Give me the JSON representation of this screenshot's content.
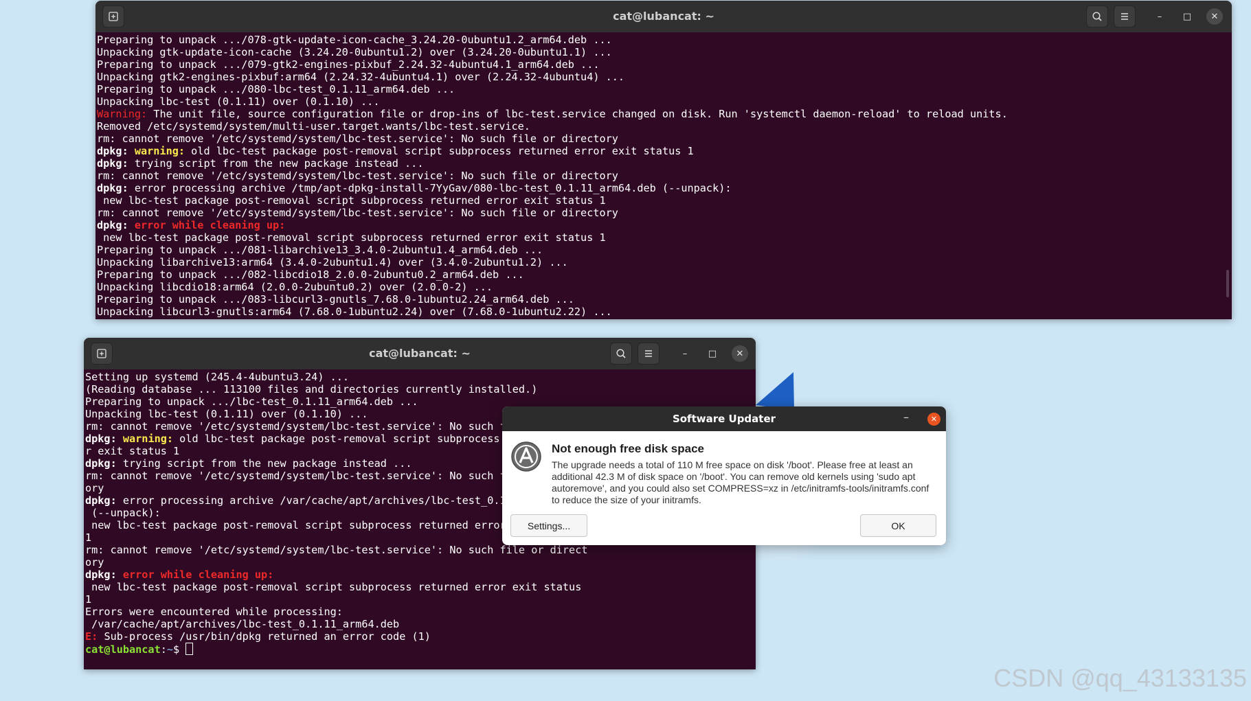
{
  "colors": {
    "terminal_bg": "#300a24",
    "titlebar_bg": "#303030",
    "dialog_accent": "#e95420",
    "error_red": "#ef2929",
    "warning_yellow": "#fce94f",
    "prompt_green": "#8ae234",
    "prompt_blue": "#729fcf",
    "desktop_bg": "#cde6f6"
  },
  "terminal_top": {
    "title": "cat@lubancat: ~",
    "icons": [
      "new-tab-icon",
      "search-icon",
      "menu-icon",
      "minimize-icon",
      "maximize-icon",
      "close-icon"
    ],
    "lines": [
      [
        {
          "t": "Preparing to unpack .../078-gtk-update-icon-cache_3.24.20-0ubuntu1.2_arm64.deb ..."
        }
      ],
      [
        {
          "t": "Unpacking gtk-update-icon-cache (3.24.20-0ubuntu1.2) over (3.24.20-0ubuntu1.1) ..."
        }
      ],
      [
        {
          "t": "Preparing to unpack .../079-gtk2-engines-pixbuf_2.24.32-4ubuntu4.1_arm64.deb ..."
        }
      ],
      [
        {
          "t": "Unpacking gtk2-engines-pixbuf:arm64 (2.24.32-4ubuntu4.1) over (2.24.32-4ubuntu4) ..."
        }
      ],
      [
        {
          "t": "Preparing to unpack .../080-lbc-test_0.1.11_arm64.deb ..."
        }
      ],
      [
        {
          "t": "Unpacking lbc-test (0.1.11) over (0.1.10) ..."
        }
      ],
      [
        {
          "t": "Warning:",
          "s": "red"
        },
        {
          "t": " The unit file, source configuration file or drop-ins of lbc-test.service changed on disk. Run 'systemctl daemon-reload' to reload units."
        }
      ],
      [
        {
          "t": "Removed /etc/systemd/system/multi-user.target.wants/lbc-test.service."
        }
      ],
      [
        {
          "t": "rm: cannot remove '/etc/systemd/system/lbc-test.service': No such file or directory"
        }
      ],
      [
        {
          "t": "dpkg:",
          "s": "b"
        },
        {
          "t": " "
        },
        {
          "t": "warning:",
          "s": "yelb"
        },
        {
          "t": " old lbc-test package post-removal script subprocess returned error exit status 1"
        }
      ],
      [
        {
          "t": "dpkg:",
          "s": "b"
        },
        {
          "t": " trying script from the new package instead ..."
        }
      ],
      [
        {
          "t": "rm: cannot remove '/etc/systemd/system/lbc-test.service': No such file or directory"
        }
      ],
      [
        {
          "t": "dpkg:",
          "s": "b"
        },
        {
          "t": " error processing archive /tmp/apt-dpkg-install-7YyGav/080-lbc-test_0.1.11_arm64.deb (--unpack):"
        }
      ],
      [
        {
          "t": " new lbc-test package post-removal script subprocess returned error exit status 1"
        }
      ],
      [
        {
          "t": "rm: cannot remove '/etc/systemd/system/lbc-test.service': No such file or directory"
        }
      ],
      [
        {
          "t": "dpkg:",
          "s": "b"
        },
        {
          "t": " "
        },
        {
          "t": "error while cleaning up:",
          "s": "redb"
        }
      ],
      [
        {
          "t": " new lbc-test package post-removal script subprocess returned error exit status 1"
        }
      ],
      [
        {
          "t": "Preparing to unpack .../081-libarchive13_3.4.0-2ubuntu1.4_arm64.deb ..."
        }
      ],
      [
        {
          "t": "Unpacking libarchive13:arm64 (3.4.0-2ubuntu1.4) over (3.4.0-2ubuntu1.2) ..."
        }
      ],
      [
        {
          "t": "Preparing to unpack .../082-libcdio18_2.0.0-2ubuntu0.2_arm64.deb ..."
        }
      ],
      [
        {
          "t": "Unpacking libcdio18:arm64 (2.0.0-2ubuntu0.2) over (2.0.0-2) ..."
        }
      ],
      [
        {
          "t": "Preparing to unpack .../083-libcurl3-gnutls_7.68.0-1ubuntu2.24_arm64.deb ..."
        }
      ],
      [
        {
          "t": "Unpacking libcurl3-gnutls:arm64 (7.68.0-1ubuntu2.24) over (7.68.0-1ubuntu2.22) ..."
        }
      ]
    ]
  },
  "terminal_bottom": {
    "title": "cat@lubancat: ~",
    "icons": [
      "new-tab-icon",
      "search-icon",
      "menu-icon",
      "minimize-icon",
      "maximize-icon",
      "close-icon"
    ],
    "lines": [
      [
        {
          "t": "Setting up systemd (245.4-4ubuntu3.24) ..."
        }
      ],
      [
        {
          "t": "(Reading database ... 113100 files and directories currently installed.)"
        }
      ],
      [
        {
          "t": "Preparing to unpack .../lbc-test_0.1.11_arm64.deb ..."
        }
      ],
      [
        {
          "t": "Unpacking lbc-test (0.1.11) over (0.1.10) ..."
        }
      ],
      [
        {
          "t": "rm: cannot remove '/etc/systemd/system/lbc-test.service': No such fi"
        }
      ],
      [
        {
          "t": "dpkg:",
          "s": "b"
        },
        {
          "t": " "
        },
        {
          "t": "warning:",
          "s": "yelb"
        },
        {
          "t": " old lbc-test package post-removal script subprocess r"
        }
      ],
      [
        {
          "t": "r exit status 1"
        }
      ],
      [
        {
          "t": "dpkg:",
          "s": "b"
        },
        {
          "t": " trying script from the new package instead ..."
        }
      ],
      [
        {
          "t": "rm: cannot remove '/etc/systemd/system/lbc-test.service': No such fi"
        }
      ],
      [
        {
          "t": "ory"
        }
      ],
      [
        {
          "t": "dpkg:",
          "s": "b"
        },
        {
          "t": " error processing archive /var/cache/apt/archives/lbc-test_0.1"
        }
      ],
      [
        {
          "t": " (--unpack):"
        }
      ],
      [
        {
          "t": " new lbc-test package post-removal script subprocess returned error"
        }
      ],
      [
        {
          "t": "1"
        }
      ],
      [
        {
          "t": "rm: cannot remove '/etc/systemd/system/lbc-test.service': No such file or direct"
        }
      ],
      [
        {
          "t": "ory"
        }
      ],
      [
        {
          "t": "dpkg:",
          "s": "b"
        },
        {
          "t": " "
        },
        {
          "t": "error while cleaning up:",
          "s": "redb"
        }
      ],
      [
        {
          "t": " new lbc-test package post-removal script subprocess returned error exit status"
        }
      ],
      [
        {
          "t": "1"
        }
      ],
      [
        {
          "t": "Errors were encountered while processing:"
        }
      ],
      [
        {
          "t": " /var/cache/apt/archives/lbc-test_0.1.11_arm64.deb"
        }
      ],
      [
        {
          "t": "E:",
          "s": "redb"
        },
        {
          "t": " Sub-process /usr/bin/dpkg returned an error code (1)"
        }
      ],
      [
        {
          "t": "cat@lubancat",
          "s": "grnb"
        },
        {
          "t": ":"
        },
        {
          "t": "~",
          "s": "blub"
        },
        {
          "t": "$ "
        }
      ]
    ]
  },
  "dialog": {
    "title": "Software Updater",
    "heading": "Not enough free disk space",
    "message": "The upgrade needs a total of 110 M free space on disk '/boot'. Please free at least an additional 42.3 M of disk space on '/boot'. You can remove old kernels using 'sudo apt autoremove', and you could also set COMPRESS=xz in /etc/initramfs-tools/initramfs.conf to reduce the size of your initramfs.",
    "settings_label": "Settings...",
    "ok_label": "OK",
    "icon": "software-updater-icon"
  },
  "watermark": "CSDN @qq_43133135"
}
